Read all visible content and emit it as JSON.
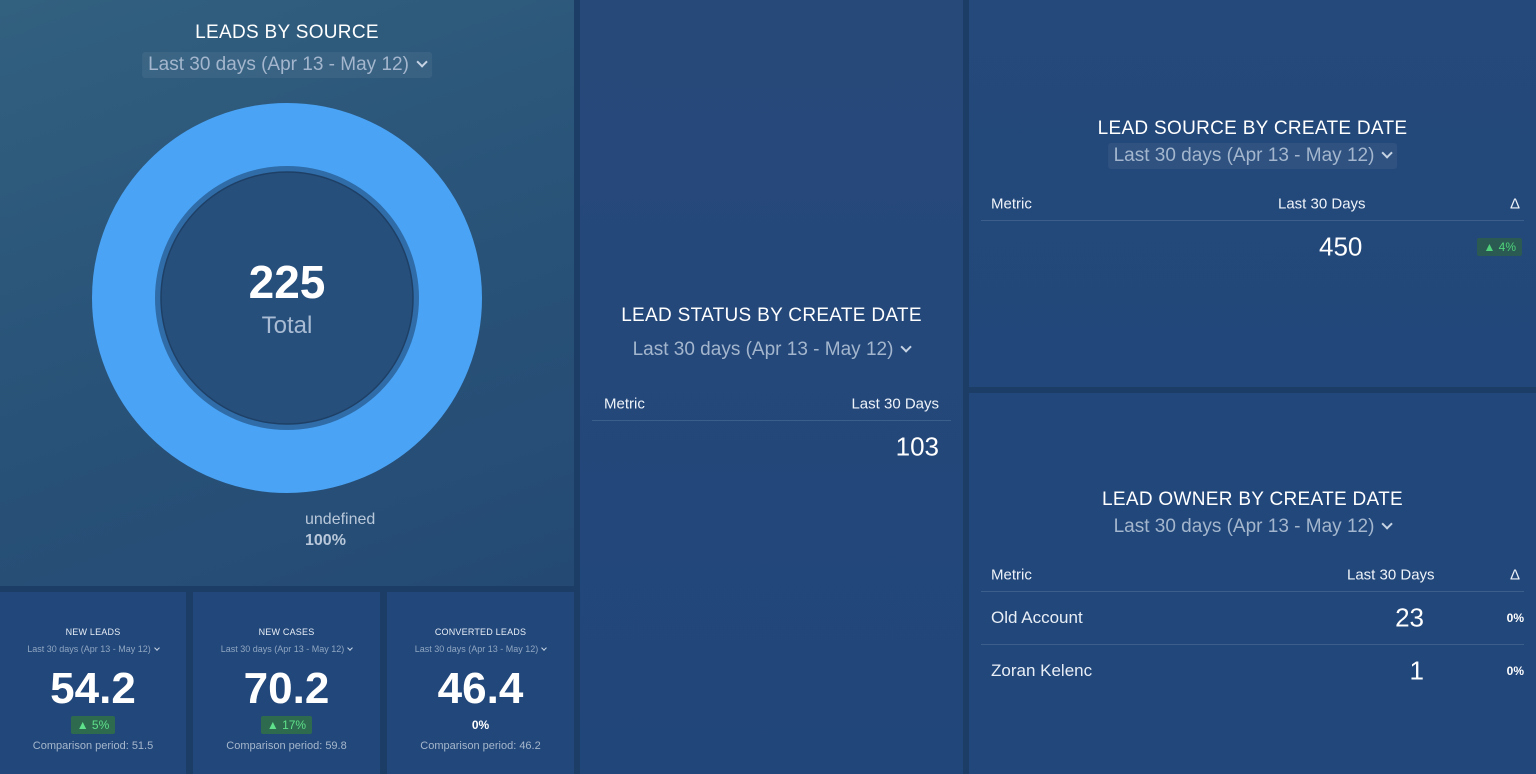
{
  "leads_by_source": {
    "title": "LEADS BY SOURCE",
    "range": "Last 30 days (Apr 13 - May 12)",
    "total_value": "225",
    "total_label": "Total",
    "legend_name": "undefined",
    "legend_pct": "100%",
    "ring_color": "#4aa3f5"
  },
  "chart_data": {
    "type": "pie",
    "title": "LEADS BY SOURCE",
    "categories": [
      "undefined"
    ],
    "values": [
      225
    ],
    "percent": [
      100
    ],
    "total": 225
  },
  "new_leads": {
    "title": "NEW LEADS",
    "range": "Last 30 days (Apr 13 - May 12)",
    "value": "54.2",
    "delta": "▲ 5%",
    "comparison": "Comparison period: 51.5"
  },
  "new_cases": {
    "title": "NEW CASES",
    "range": "Last 30 days (Apr 13 - May 12)",
    "value": "70.2",
    "delta": "▲ 17%",
    "comparison": "Comparison period: 59.8"
  },
  "converted_leads": {
    "title": "CONVERTED LEADS",
    "range": "Last 30 days (Apr 13 - May 12)",
    "value": "46.4",
    "delta": "0%",
    "comparison": "Comparison period: 46.2"
  },
  "lead_status": {
    "title": "LEAD STATUS BY CREATE DATE",
    "range": "Last 30 days (Apr 13 - May 12)",
    "col_metric": "Metric",
    "col_period": "Last 30 Days",
    "value": "103"
  },
  "lead_source_date": {
    "title": "LEAD SOURCE BY CREATE DATE",
    "range": "Last 30 days (Apr 13 - May 12)",
    "col_metric": "Metric",
    "col_period": "Last 30 Days",
    "col_delta": "Δ",
    "value": "450",
    "delta": "▲ 4%"
  },
  "lead_owner": {
    "title": "LEAD OWNER BY CREATE DATE",
    "range": "Last 30 days (Apr 13 - May 12)",
    "col_metric": "Metric",
    "col_period": "Last 30 Days",
    "col_delta": "Δ",
    "rows": [
      {
        "name": "Old Account",
        "value": "23",
        "delta": "0%"
      },
      {
        "name": "Zoran Kelenc",
        "value": "1",
        "delta": "0%"
      }
    ]
  }
}
